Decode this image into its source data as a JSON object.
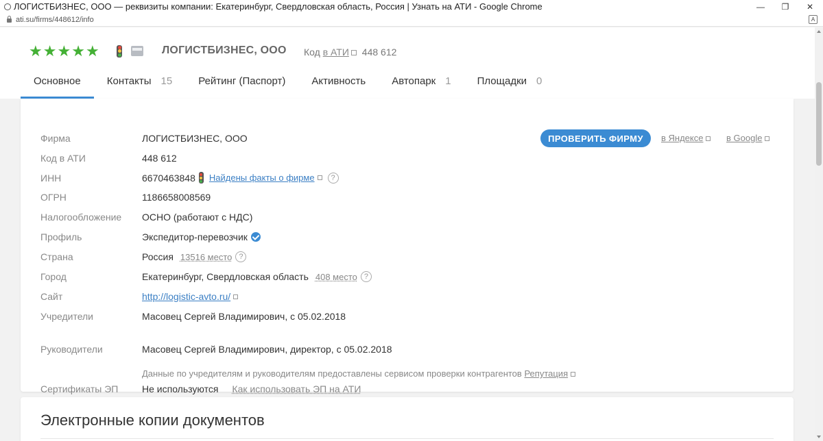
{
  "browser": {
    "window_title": "ЛОГИСТБИЗНЕС, ООО — реквизиты компании: Екатеринбург, Свердловская область, Россия | Узнать на АТИ - Google Chrome",
    "url": "ati.su/firms/448612/info"
  },
  "header": {
    "company_name": "ЛОГИСТБИЗНЕС, ООО",
    "code_label": "Код",
    "code_link": "в АТИ",
    "code_value": "448 612",
    "rating_stars": 5,
    "colors": {
      "star": "#44b035",
      "accent": "#3b8bd3"
    }
  },
  "tabs": [
    {
      "label": "Основное",
      "count": ""
    },
    {
      "label": "Контакты",
      "count": "15"
    },
    {
      "label": "Рейтинг (Паспорт)",
      "count": ""
    },
    {
      "label": "Активность",
      "count": ""
    },
    {
      "label": "Автопарк",
      "count": "1"
    },
    {
      "label": "Площадки",
      "count": "0"
    }
  ],
  "actions": {
    "check_button": "ПРОВЕРИТЬ ФИРМУ",
    "yandex_link": "в Яндексе",
    "google_link": "в Google"
  },
  "details": {
    "firm": {
      "label": "Фирма",
      "value": "ЛОГИСТБИЗНЕС, ООО"
    },
    "ati_code": {
      "label": "Код в АТИ",
      "value": "448 612"
    },
    "inn": {
      "label": "ИНН",
      "value": "6670463848",
      "facts_link": "Найдены факты о фирме"
    },
    "ogrn": {
      "label": "ОГРН",
      "value": "1186658008569"
    },
    "tax": {
      "label": "Налогообложение",
      "value": "ОСНО (работают с НДС)"
    },
    "profile": {
      "label": "Профиль",
      "value": "Экспедитор-перевозчик"
    },
    "country": {
      "label": "Страна",
      "value": "Россия",
      "rank": "13516 место"
    },
    "city": {
      "label": "Город",
      "value": "Екатеринбург, Свердловская область",
      "rank": "408 место"
    },
    "site": {
      "label": "Сайт",
      "value": "http://logistic-avto.ru/"
    },
    "founders": {
      "label": "Учредители",
      "value": "Масовец Сергей Владимирович, с 05.02.2018"
    },
    "managers": {
      "label": "Руководители",
      "value": "Масовец Сергей Владимирович, директор, с 05.02.2018"
    },
    "note": "Данные по учредителям и руководителям предоставлены сервисом проверки контрагентов",
    "note_link": "Репутация",
    "certificates": {
      "label": "Сертификаты ЭП",
      "value": "Не используются",
      "help_link": "Как использовать ЭП на АТИ"
    }
  },
  "documents": {
    "title": "Электронные копии документов"
  }
}
